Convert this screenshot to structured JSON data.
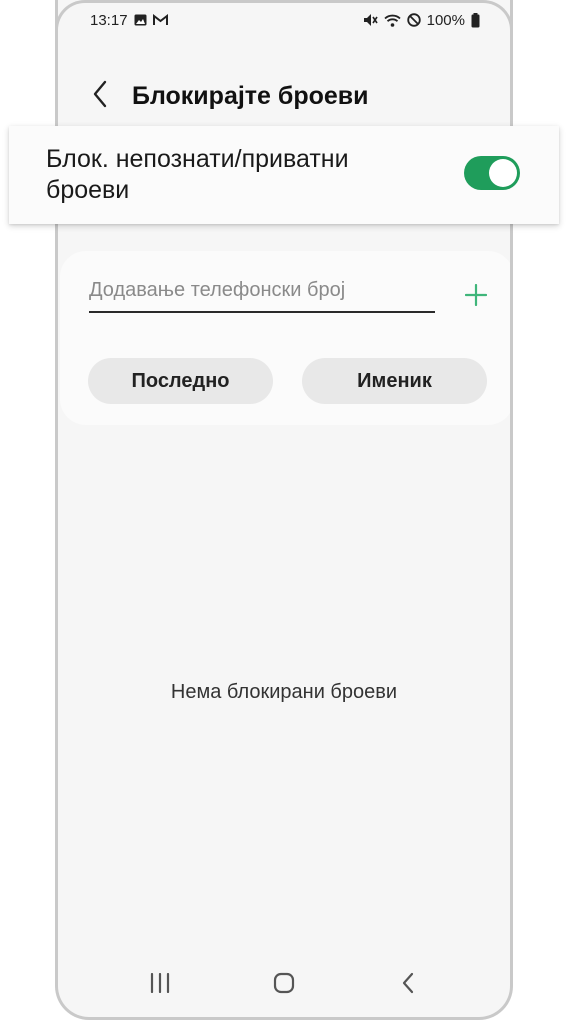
{
  "status_bar": {
    "time": "13:17",
    "battery": "100%",
    "left_icons": [
      "image-icon",
      "gmail-icon"
    ],
    "right_icons": [
      "mute-icon",
      "wifi-icon",
      "do-not-disturb-icon",
      "battery-icon"
    ]
  },
  "header": {
    "back_icon": "chevron-left-icon",
    "title": "Блокирајте броеви"
  },
  "block_unknown": {
    "label": "Блок. непознати/приватни броеви",
    "enabled": true,
    "accent": "#1f9d5b"
  },
  "add_number": {
    "placeholder": "Додавање телефонски број",
    "value": "",
    "add_icon": "plus-icon",
    "add_icon_color": "#3fb57a"
  },
  "buttons": {
    "recent": "Последно",
    "contacts": "Именик"
  },
  "empty_state": "Нема блокирани броеви",
  "nav": [
    "recents-icon",
    "home-icon",
    "back-icon"
  ]
}
